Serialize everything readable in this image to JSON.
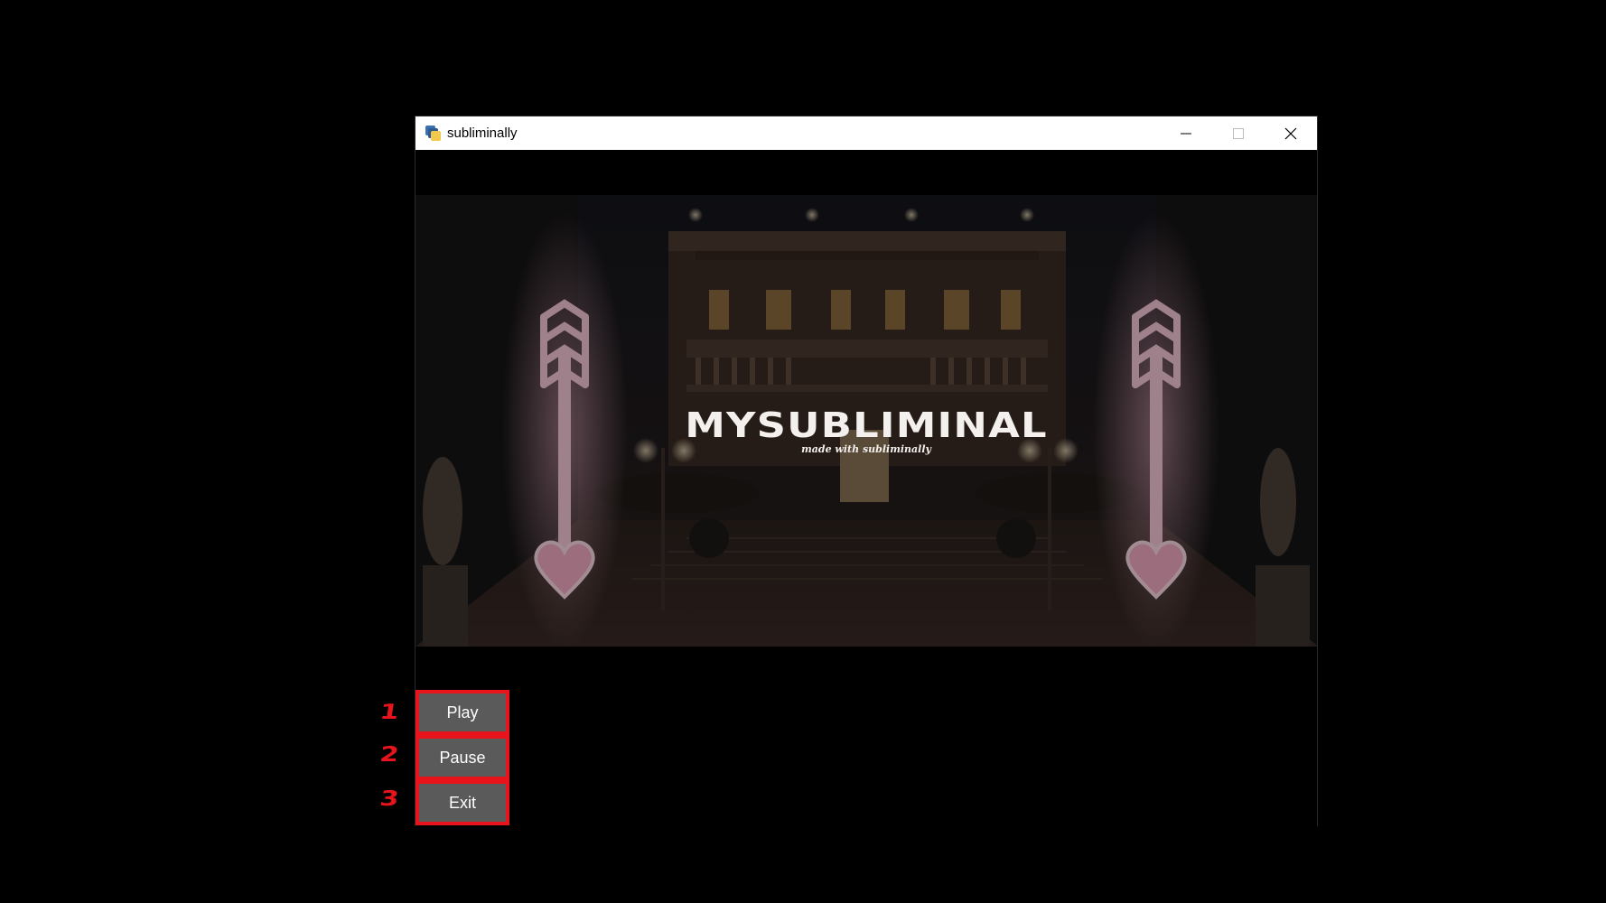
{
  "window": {
    "title": "subliminally",
    "icon": "python-app-icon",
    "controls": [
      "minimize-icon",
      "maximize-icon",
      "close-icon"
    ]
  },
  "video": {
    "title": "MYSUBLIMINAL",
    "subtitle": "made with subliminally"
  },
  "buttons": [
    {
      "label": "Play",
      "number": "1"
    },
    {
      "label": "Pause",
      "number": "2"
    },
    {
      "label": "Exit",
      "number": "3"
    }
  ],
  "colors": {
    "annotation": "#e8141c",
    "button_bg": "#5a5a5a",
    "neon": "#f09ab8"
  }
}
